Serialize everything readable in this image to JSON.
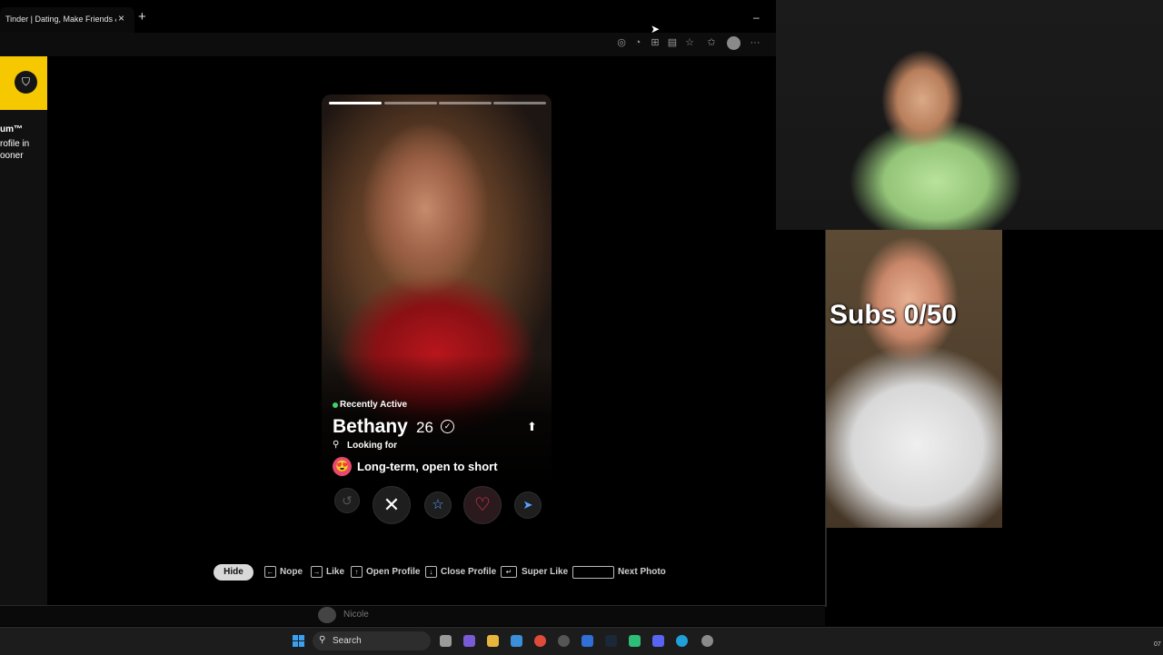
{
  "browser": {
    "tab_title": "Tinder | Dating, Make Friends & M",
    "tab_close": "×",
    "new_tab": "+",
    "minimize": "–",
    "toolbar_icons": [
      "location-icon",
      "bell-icon",
      "apps-icon",
      "reading-list-icon",
      "favorite-star-icon",
      "favorites-icon",
      "profile-icon",
      "more-icon"
    ],
    "more": "···"
  },
  "sidebar": {
    "promo_title": "um™",
    "promo_line1": "rofile in",
    "promo_line2": "ooner",
    "promo_color": "#f5c800"
  },
  "card": {
    "status": "Recently Active",
    "name": "Bethany",
    "age": "26",
    "looking_for_label": "Looking for",
    "intent_emoji": "😍",
    "intent": "Long-term, open to short",
    "photo_count": 4,
    "current_photo": 1
  },
  "actions": {
    "rewind": "↺",
    "nope": "✕",
    "super_like": "☆",
    "like": "♡",
    "boost": "➤"
  },
  "shortcuts": {
    "hide": "Hide",
    "nope": "Nope",
    "like": "Like",
    "open_profile": "Open Profile",
    "close_profile": "Close Profile",
    "super_like": "Super Like",
    "next_photo": "Next Photo"
  },
  "below_page": {
    "name": "Nicole"
  },
  "overlay": {
    "subs": "Subs 0/50"
  },
  "taskbar": {
    "search_label": "Search",
    "clock": "07"
  }
}
